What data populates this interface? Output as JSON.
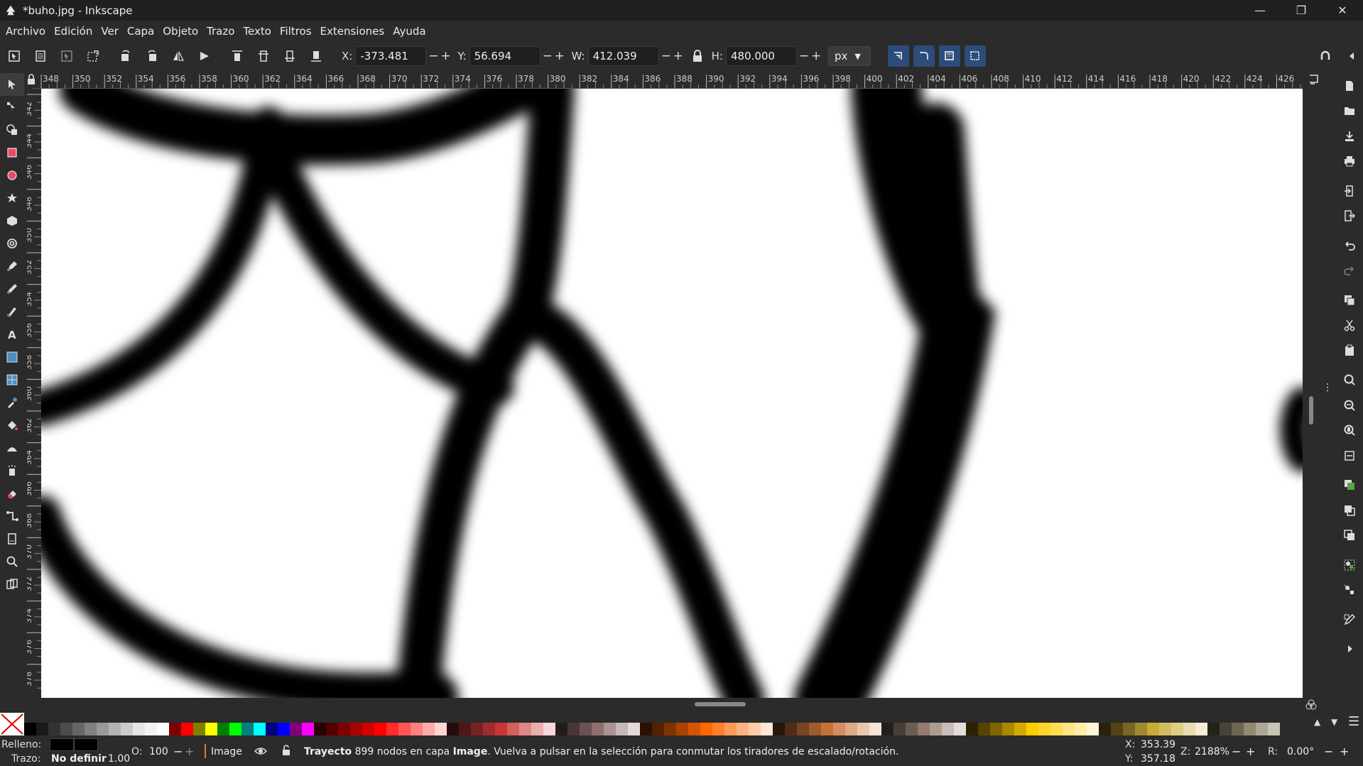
{
  "window": {
    "title": "*buho.jpg - Inkscape",
    "minimize": "—",
    "maximize": "❐",
    "close": "✕"
  },
  "menu": [
    "Archivo",
    "Edición",
    "Ver",
    "Capa",
    "Objeto",
    "Trazo",
    "Texto",
    "Filtros",
    "Extensiones",
    "Ayuda"
  ],
  "toolbar": {
    "x_label": "X:",
    "x_value": "-373.481",
    "y_label": "Y:",
    "y_value": "56.694",
    "w_label": "W:",
    "w_value": "412.039",
    "h_label": "H:",
    "h_value": "480.000",
    "unit": "px",
    "minus": "−",
    "plus": "+"
  },
  "ruler": {
    "top_labels": [
      "348",
      "350",
      "352",
      "354",
      "356",
      "358",
      "360",
      "362",
      "364",
      "366",
      "368",
      "370",
      "372",
      "374",
      "376",
      "378",
      "380",
      "382",
      "384",
      "386",
      "388",
      "390",
      "392",
      "394",
      "396",
      "398",
      "400",
      "402",
      "404",
      "406",
      "408",
      "410",
      "412",
      "414",
      "416",
      "418",
      "420",
      "422",
      "424",
      "426"
    ],
    "left_labels": [
      "342",
      "344",
      "346",
      "348",
      "350",
      "352",
      "354",
      "356",
      "358",
      "360",
      "362",
      "364",
      "366",
      "368",
      "370",
      "372",
      "374",
      "376",
      "378"
    ]
  },
  "palette_colors": [
    "#000000",
    "#1a1a1a",
    "#333333",
    "#4d4d4d",
    "#666666",
    "#808080",
    "#999999",
    "#b3b3b3",
    "#cccccc",
    "#e6e6e6",
    "#f2f2f2",
    "#ffffff",
    "#800000",
    "#ff0000",
    "#808000",
    "#ffff00",
    "#008000",
    "#00ff00",
    "#008080",
    "#00ffff",
    "#000080",
    "#0000ff",
    "#800080",
    "#ff00ff",
    "#2b0000",
    "#550000",
    "#800000",
    "#aa0000",
    "#d40000",
    "#ff0000",
    "#ff2a2a",
    "#ff5555",
    "#ff8080",
    "#ffaaaa",
    "#ffd5d5",
    "#280b0b",
    "#501616",
    "#782121",
    "#a02c2c",
    "#c83737",
    "#d35f5f",
    "#de8787",
    "#e9afaf",
    "#f4d7d7",
    "#241c1c",
    "#483737",
    "#6c5353",
    "#916f6f",
    "#ac9393",
    "#c8b7b7",
    "#e3dbdb",
    "#2b1100",
    "#552200",
    "#803300",
    "#aa4400",
    "#d45500",
    "#ff6600",
    "#ff7f2a",
    "#ff9955",
    "#ffb380",
    "#ffccaa",
    "#ffe6d5",
    "#28170b",
    "#502d16",
    "#784421",
    "#a05a2c",
    "#c87137",
    "#d38d5f",
    "#deaa87",
    "#e9c6af",
    "#f4e3d7",
    "#241f1c",
    "#483e37",
    "#6c5d53",
    "#917c6f",
    "#ac9d93",
    "#c8beb7",
    "#e3dedb",
    "#2b2200",
    "#554400",
    "#806600",
    "#aa8800",
    "#d4aa00",
    "#ffcc00",
    "#ffd42a",
    "#ffdd55",
    "#ffe680",
    "#ffeeaa",
    "#fff6d5",
    "#28220b",
    "#504416",
    "#786721",
    "#a0892c",
    "#c8ab37",
    "#d3bc5f",
    "#decd87",
    "#e9ddaf",
    "#f4eed7",
    "#24221c",
    "#484537",
    "#6c6753",
    "#918a6f",
    "#aca793",
    "#c8c4b7"
  ],
  "status": {
    "fill_label": "Relleno:",
    "stroke_label": "Trazo:",
    "stroke_value": "No definir",
    "stroke_width": "1.00",
    "opacity_label": "O:",
    "opacity_value": "100",
    "layer_name": "Image",
    "message_bold": "Trayecto",
    "message": " 899 nodos en capa ",
    "message_layer": "Image",
    "message_tail": ". Vuelva a pulsar en la selección para conmutar los tiradores de escalado/rotación.",
    "cursor_x_label": "X:",
    "cursor_x": "353.39",
    "cursor_y_label": "Y:",
    "cursor_y": "357.18",
    "zoom_label": "Z:",
    "zoom": "2188%",
    "rotate_label": "R:",
    "rotate": "0.00°"
  }
}
